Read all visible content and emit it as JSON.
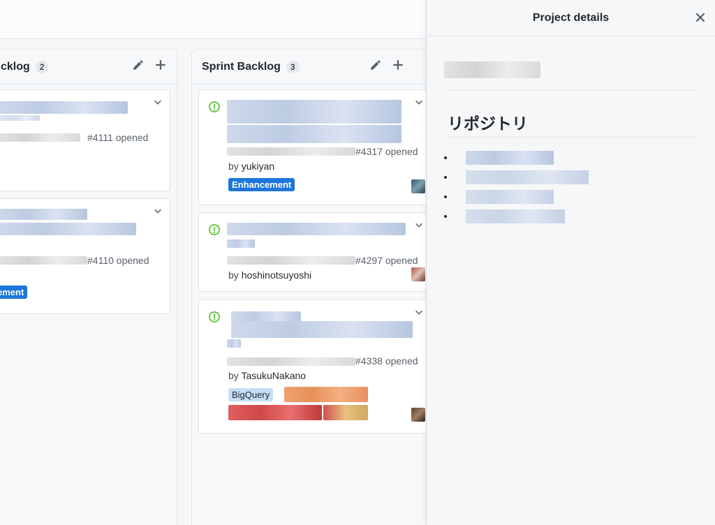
{
  "panel": {
    "title": "Project details",
    "heading": "リポジトリ",
    "repo_items": 4
  },
  "columns": [
    {
      "title": "cklog",
      "count": "2",
      "cards": [
        {
          "meta": "#4111 opened"
        },
        {
          "meta": "#4110 opened",
          "label": "ement"
        }
      ]
    },
    {
      "title": "Sprint Backlog",
      "count": "3",
      "cards": [
        {
          "meta": "#4317 opened",
          "by_prefix": "by ",
          "author": "yukiyan",
          "label": "Enhancement"
        },
        {
          "meta": "#4297 opened",
          "by_prefix": "by ",
          "author": "hoshinotsuyoshi"
        },
        {
          "meta": "#4338 opened",
          "by_prefix": "by ",
          "author": "TasukuNakano",
          "label": "BigQuery"
        }
      ]
    }
  ],
  "colors": {
    "enhancement": "#1d76db",
    "bigquery": "#c5def5",
    "open_issue": "#6cc644"
  },
  "icons": [
    "pencil-icon",
    "plus-icon",
    "chevron-down-icon",
    "issue-opened-icon",
    "close-icon"
  ]
}
